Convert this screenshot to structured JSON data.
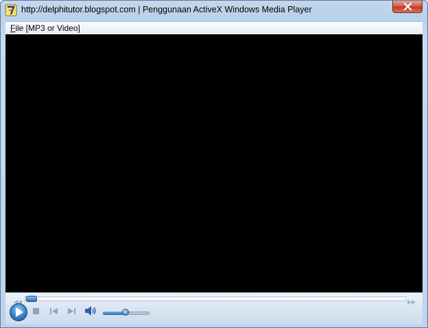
{
  "window": {
    "title": "http://delphitutor.blogspot.com | Penggunaan ActiveX Windows Media Player",
    "icon": "delphi-app-icon"
  },
  "menu": {
    "file_accel": "F",
    "file_rest": "ile [MP3 or Video]"
  },
  "player": {
    "seek_position": 0,
    "volume_level": 0.5,
    "icons": {
      "play": "play-icon",
      "stop": "stop-icon",
      "previous": "previous-icon",
      "next": "next-icon",
      "mute": "speaker-icon",
      "seek_back": "rewind-icon",
      "seek_forward": "fast-forward-icon"
    }
  },
  "colors": {
    "video_background": "#000000",
    "accent": "#2c6fb8",
    "close_button": "#c13d26"
  }
}
